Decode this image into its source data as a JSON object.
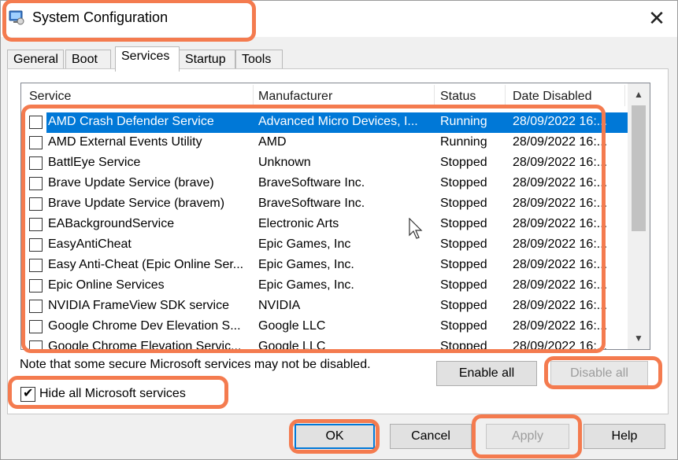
{
  "window": {
    "title": "System Configuration",
    "close_glyph": "✕",
    "app_icon": "msconfig-icon"
  },
  "tabs": [
    {
      "label": "General",
      "active": false
    },
    {
      "label": "Boot",
      "active": false
    },
    {
      "label": "Services",
      "active": true
    },
    {
      "label": "Startup",
      "active": false
    },
    {
      "label": "Tools",
      "active": false
    }
  ],
  "table": {
    "columns": [
      "Service",
      "Manufacturer",
      "Status",
      "Date Disabled"
    ],
    "rows": [
      {
        "service": "AMD Crash Defender Service",
        "manufacturer": "Advanced Micro Devices, I...",
        "status": "Running",
        "date": "28/09/2022 16:...",
        "checked": false,
        "selected": true
      },
      {
        "service": "AMD External Events Utility",
        "manufacturer": "AMD",
        "status": "Running",
        "date": "28/09/2022 16:...",
        "checked": false,
        "selected": false
      },
      {
        "service": "BattlEye Service",
        "manufacturer": "Unknown",
        "status": "Stopped",
        "date": "28/09/2022 16:...",
        "checked": false,
        "selected": false
      },
      {
        "service": "Brave Update Service (brave)",
        "manufacturer": "BraveSoftware Inc.",
        "status": "Stopped",
        "date": "28/09/2022 16:...",
        "checked": false,
        "selected": false
      },
      {
        "service": "Brave Update Service (bravem)",
        "manufacturer": "BraveSoftware Inc.",
        "status": "Stopped",
        "date": "28/09/2022 16:...",
        "checked": false,
        "selected": false
      },
      {
        "service": "EABackgroundService",
        "manufacturer": "Electronic Arts",
        "status": "Stopped",
        "date": "28/09/2022 16:...",
        "checked": false,
        "selected": false
      },
      {
        "service": "EasyAntiCheat",
        "manufacturer": "Epic Games, Inc",
        "status": "Stopped",
        "date": "28/09/2022 16:...",
        "checked": false,
        "selected": false
      },
      {
        "service": "Easy Anti-Cheat (Epic Online Ser...",
        "manufacturer": "Epic Games, Inc.",
        "status": "Stopped",
        "date": "28/09/2022 16:...",
        "checked": false,
        "selected": false
      },
      {
        "service": "Epic Online Services",
        "manufacturer": "Epic Games, Inc.",
        "status": "Stopped",
        "date": "28/09/2022 16:...",
        "checked": false,
        "selected": false
      },
      {
        "service": "NVIDIA FrameView SDK service",
        "manufacturer": "NVIDIA",
        "status": "Stopped",
        "date": "28/09/2022 16:...",
        "checked": false,
        "selected": false
      },
      {
        "service": "Google Chrome Dev Elevation S...",
        "manufacturer": "Google LLC",
        "status": "Stopped",
        "date": "28/09/2022 16:...",
        "checked": false,
        "selected": false
      },
      {
        "service": "Google Chrome Elevation Servic...",
        "manufacturer": "Google LLC",
        "status": "Stopped",
        "date": "28/09/2022 16:...",
        "checked": false,
        "selected": false
      }
    ]
  },
  "scroll": {
    "up_glyph": "▲",
    "down_glyph": "▼"
  },
  "note": "Note that some secure Microsoft services may not be disabled.",
  "buttons": {
    "enable_all": "Enable all",
    "disable_all": "Disable all",
    "ok": "OK",
    "cancel": "Cancel",
    "apply": "Apply",
    "help": "Help"
  },
  "hide_ms": {
    "label": "Hide all Microsoft services",
    "checked": true,
    "tick": "✔"
  },
  "colors": {
    "selection": "#0078d7",
    "highlight": "#f47b4f"
  }
}
